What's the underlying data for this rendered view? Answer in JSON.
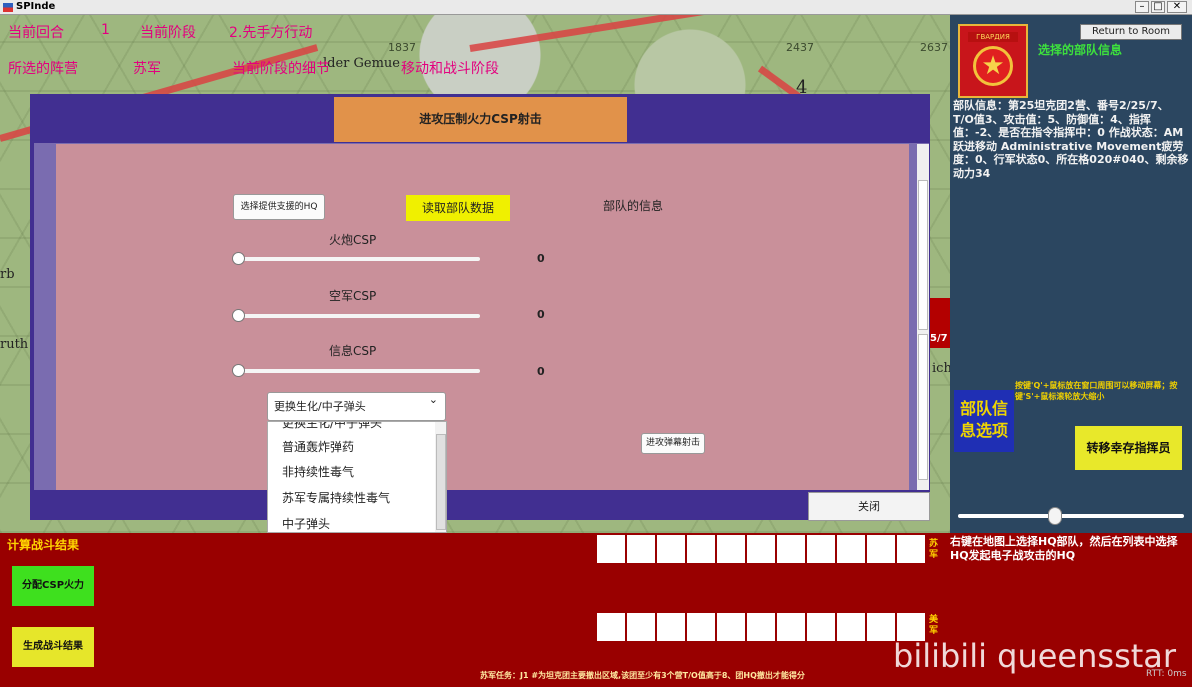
{
  "window": {
    "title": "SPInde",
    "min": "–",
    "max": "□",
    "close": "✕"
  },
  "map": {
    "hex_numbers": [
      "2437",
      "2637",
      "1837"
    ],
    "labels": [
      "lder Gemue",
      "rb",
      "ruth",
      "4",
      "ich"
    ],
    "counter_text": "5/7"
  },
  "top_info": {
    "turn_label": "当前回合",
    "turn_value": "1",
    "phase_label": "当前阶段",
    "phase_value": "2.先手方行动",
    "faction_label": "所选的阵营",
    "faction_value": "苏军",
    "stage_label": "当前阶段的细节",
    "stage_value": "移动和战斗阶段"
  },
  "right_panel": {
    "badge_text": "ГВАРДИЯ",
    "badge_star": "★",
    "return_button": "Return to Room",
    "selected_title": "选择的部队信息",
    "unit_info": "部队信息：第25坦克团2营、番号2/25/7、T/O值3、攻击值：5、防御值：4、指挥值：-2、是否在指令指挥中：0 作战状态：AM跃进移动 Administrative Movement疲劳度：0、行军状态0、所在格020#040、剩余移动力34",
    "key_hint": "按键'Q'+鼠标放在窗口周围可以移动屏幕；按键'S'+鼠标滚轮放大缩小",
    "unit_option_button": "部队信息选项",
    "transfer_button": "转移幸存指挥员"
  },
  "dialog": {
    "header": "进攻压制火力CSP射击",
    "select_hq_button": "选择提供支援的HQ",
    "read_data_button": "读取部队数据",
    "unit_info_label": "部队的信息",
    "sliders": [
      {
        "label": "火炮CSP",
        "value": "0"
      },
      {
        "label": "空军CSP",
        "value": "0"
      },
      {
        "label": "信息CSP",
        "value": "0"
      }
    ],
    "warhead_select": {
      "selected": "更换生化/中子弹头",
      "chevron": "⌄"
    },
    "warhead_options": [
      "更换生化/中子弹头",
      "普通轰炸弹药",
      "非持续性毒气",
      "苏军专属持续性毒气",
      "中子弹头"
    ],
    "barrage_button": "进攻弹幕射击",
    "close_button": "关闭"
  },
  "bottom": {
    "calc_title": "计算战斗结果",
    "assign_csp_button": "分配CSP火力",
    "generate_result_button": "生成战斗结果",
    "soviet_label": "苏军",
    "us_label": "美军",
    "hq_hint": "右键在地图上选择HQ部队，然后在列表中选择HQ发起电子战攻击的HQ",
    "mission": "苏军任务：J1 #为坦克团主要撤出区域,该团至少有3个营T/O值高于8、团HQ撤出才能得分",
    "rtt": "RTT: 0ms",
    "watermark": "bilibili queensstar"
  }
}
